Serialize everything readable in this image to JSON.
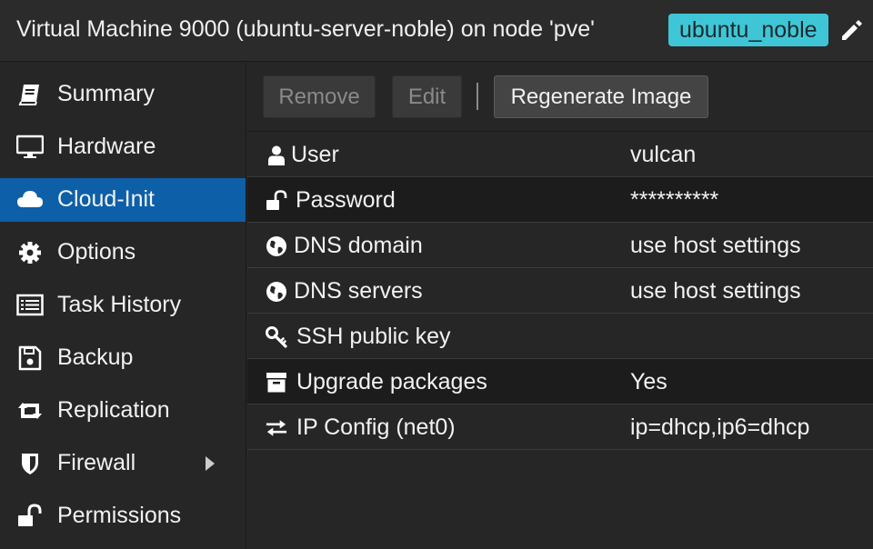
{
  "header": {
    "title": "Virtual Machine 9000 (ubuntu-server-noble) on node 'pve'",
    "tag": "ubuntu_noble",
    "edit_icon": "pencil-icon"
  },
  "sidebar": {
    "active": "Cloud-Init",
    "items": [
      {
        "label": "Summary",
        "icon": "book-icon"
      },
      {
        "label": "Hardware",
        "icon": "monitor-icon"
      },
      {
        "label": "Cloud-Init",
        "icon": "cloud-icon"
      },
      {
        "label": "Options",
        "icon": "gear-icon"
      },
      {
        "label": "Task History",
        "icon": "list-icon"
      },
      {
        "label": "Backup",
        "icon": "floppy-icon"
      },
      {
        "label": "Replication",
        "icon": "retweet-icon"
      },
      {
        "label": "Firewall",
        "icon": "shield-icon"
      },
      {
        "label": "Permissions",
        "icon": "unlock-icon"
      }
    ]
  },
  "toolbar": {
    "remove_label": "Remove",
    "edit_label": "Edit",
    "regenerate_label": "Regenerate Image"
  },
  "cloudinit": {
    "rows": [
      {
        "key": "User",
        "value": "vulcan",
        "icon": "user-icon"
      },
      {
        "key": "Password",
        "value": "**********",
        "icon": "unlock-icon"
      },
      {
        "key": "DNS domain",
        "value": "use host settings",
        "icon": "globe-icon"
      },
      {
        "key": "DNS servers",
        "value": "use host settings",
        "icon": "globe-icon"
      },
      {
        "key": "SSH public key",
        "value": "",
        "icon": "key-icon"
      },
      {
        "key": "Upgrade packages",
        "value": "Yes",
        "icon": "archive-icon"
      },
      {
        "key": "IP Config (net0)",
        "value": "ip=dhcp,ip6=dhcp",
        "icon": "exchange-icon"
      }
    ]
  },
  "colors": {
    "accent": "#0d5fa8",
    "tag_background": "#3fc6d6",
    "background": "#262626"
  }
}
